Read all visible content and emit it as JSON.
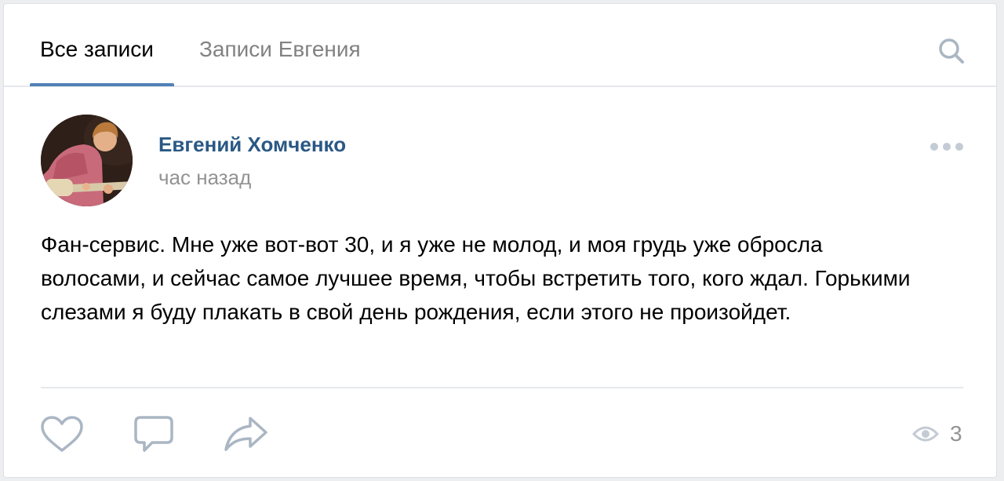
{
  "tabs": [
    {
      "label": "Все записи",
      "active": true
    },
    {
      "label": "Записи Евгения",
      "active": false
    }
  ],
  "icons": {
    "search": "search-icon",
    "more": "more-icon",
    "like": "heart-icon",
    "comment": "comment-icon",
    "share": "share-icon",
    "views": "eye-icon"
  },
  "post": {
    "author": "Евгений Хомченко",
    "time": "час назад",
    "text": "Фан-сервис. Мне уже вот-вот 30, и я уже не молод, и моя грудь уже обросла волосами, и сейчас самое лучшее время, чтобы встретить того, кого ждал. Горькими слезами я буду плакать в свой день рождения, если этого не произойдет.",
    "views": "3"
  },
  "colors": {
    "accent": "#5181b8",
    "author_link": "#2a5885",
    "muted": "#939393",
    "icon": "#aab6c3"
  }
}
